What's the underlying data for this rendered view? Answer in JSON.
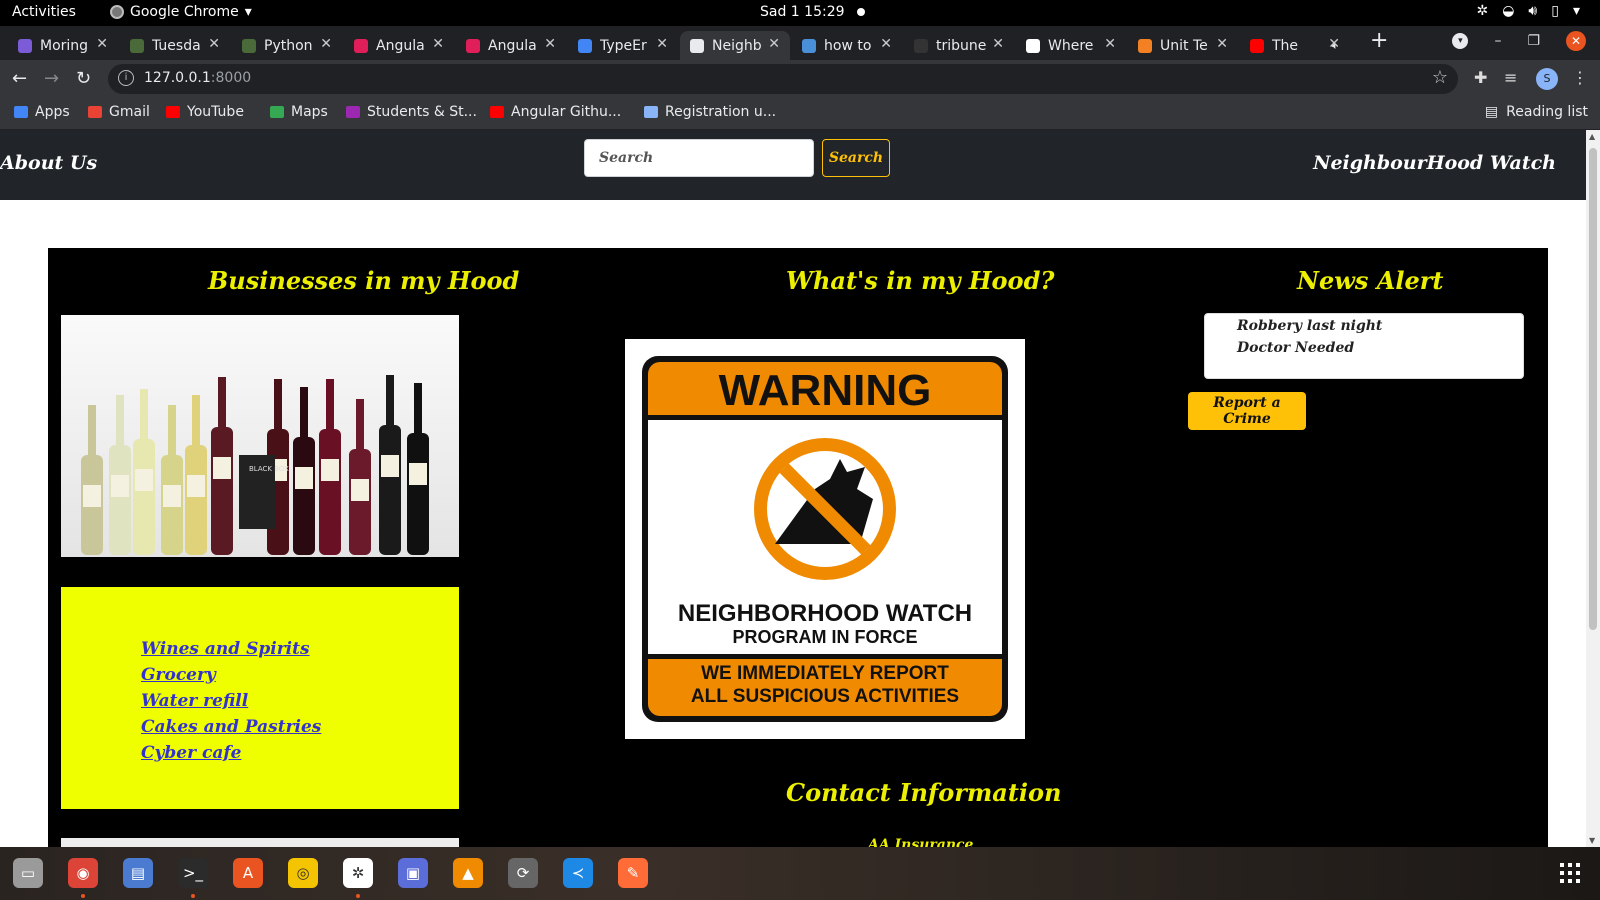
{
  "system": {
    "activities": "Activities",
    "app_name": "Google Chrome",
    "clock": "Sad 1  15:29"
  },
  "tabs": [
    {
      "title": "Moring",
      "color": "#7b5cd6"
    },
    {
      "title": "Tuesda",
      "color": "#4a6a3a"
    },
    {
      "title": "Python",
      "color": "#4a6a3a"
    },
    {
      "title": "Angula",
      "color": "#e01e5a"
    },
    {
      "title": "Angula",
      "color": "#e01e5a"
    },
    {
      "title": "TypeEr",
      "color": "#4285f4"
    },
    {
      "title": "Neighb",
      "color": "#e8eaed",
      "active": true
    },
    {
      "title": "how to",
      "color": "#4a90d9"
    },
    {
      "title": "tribune",
      "color": "#333333"
    },
    {
      "title": "Where",
      "color": "#ffffff"
    },
    {
      "title": "Unit Te",
      "color": "#f48024"
    },
    {
      "title": "The",
      "color": "#ff0000"
    }
  ],
  "address": {
    "host": "127.0.0.1",
    "port": ":8000"
  },
  "profile_initial": "S",
  "bookmarks": [
    {
      "label": "Apps",
      "color": "#4285f4"
    },
    {
      "label": "Gmail",
      "color": "#ea4335"
    },
    {
      "label": "YouTube",
      "color": "#ff0000"
    },
    {
      "label": "Maps",
      "color": "#34a853"
    },
    {
      "label": "Students & St...",
      "color": "#9c27b0"
    },
    {
      "label": "Angular Githu...",
      "color": "#ff0000"
    },
    {
      "label": "Registration u...",
      "color": "#8ab4f8"
    }
  ],
  "reading_list": "Reading list",
  "site": {
    "about": "About Us",
    "brand": "NeighbourHood Watch",
    "search_placeholder": "Search",
    "search_button": "Search",
    "businesses_heading": "Businesses in my Hood",
    "businesses": [
      "Wines and Spirits",
      "Grocery",
      "Water refill",
      "Cakes and Pastries",
      "Cyber cafe"
    ],
    "hood_heading": "What's in my Hood?",
    "sign": {
      "top": "WARNING",
      "line1": "NEIGHBORHOOD WATCH",
      "line2": "PROGRAM IN FORCE",
      "line3": "WE IMMEDIATELY REPORT",
      "line4": "ALL SUSPICIOUS ACTIVITIES"
    },
    "contact_heading": "Contact Information",
    "contact_first": "AA Insurance",
    "news_heading": "News Alert",
    "news": [
      "Robbery last night",
      "Doctor Needed"
    ],
    "report_button": "Report a Crime",
    "bottle_label": "BLACK BOX"
  },
  "dock_apps": [
    "files",
    "chrome",
    "text-editor",
    "terminal",
    "software-center",
    "rhythmbox",
    "slack",
    "screenshot",
    "vlc",
    "updater",
    "vscode",
    "postman"
  ]
}
